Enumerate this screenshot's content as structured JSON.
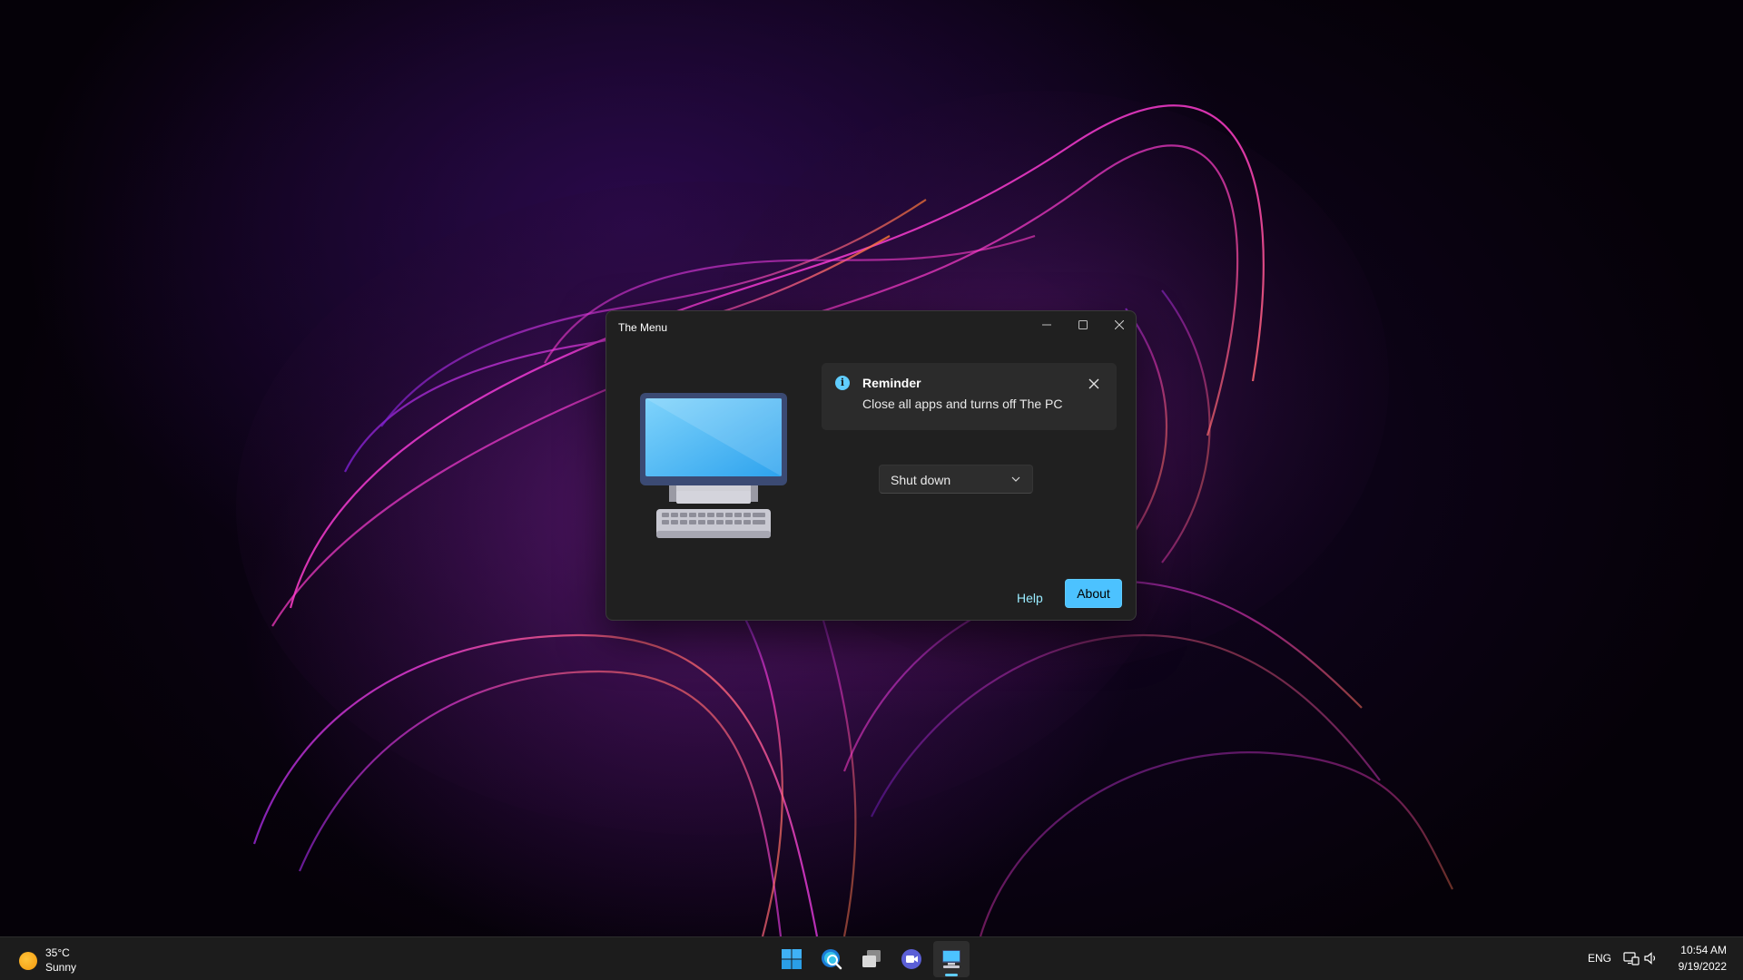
{
  "window": {
    "title": "The Menu",
    "minimize_icon": "minimize-icon",
    "maximize_icon": "maximize-icon",
    "close_icon": "close-icon"
  },
  "illustration": {
    "icon": "desktop-computer-icon"
  },
  "infobar": {
    "title": "Reminder",
    "message": "Close all apps and turns off The PC",
    "icon": "info-icon",
    "accent": "#60cdff"
  },
  "action_select": {
    "value": "Shut down"
  },
  "footer": {
    "help_label": "Help",
    "about_label": "About",
    "accent": "#4cc2ff"
  },
  "taskbar": {
    "weather": {
      "temp": "35°C",
      "condition": "Sunny",
      "icon": "sun-icon"
    },
    "apps": [
      {
        "name": "start",
        "icon": "windows-start-icon"
      },
      {
        "name": "search",
        "icon": "search-icon"
      },
      {
        "name": "task-view",
        "icon": "task-view-icon"
      },
      {
        "name": "chat",
        "icon": "chat-icon"
      },
      {
        "name": "the-menu",
        "icon": "desktop-computer-icon",
        "active": true
      }
    ],
    "tray": {
      "language": "ENG",
      "time": "10:54 AM",
      "date": "9/19/2022"
    }
  }
}
